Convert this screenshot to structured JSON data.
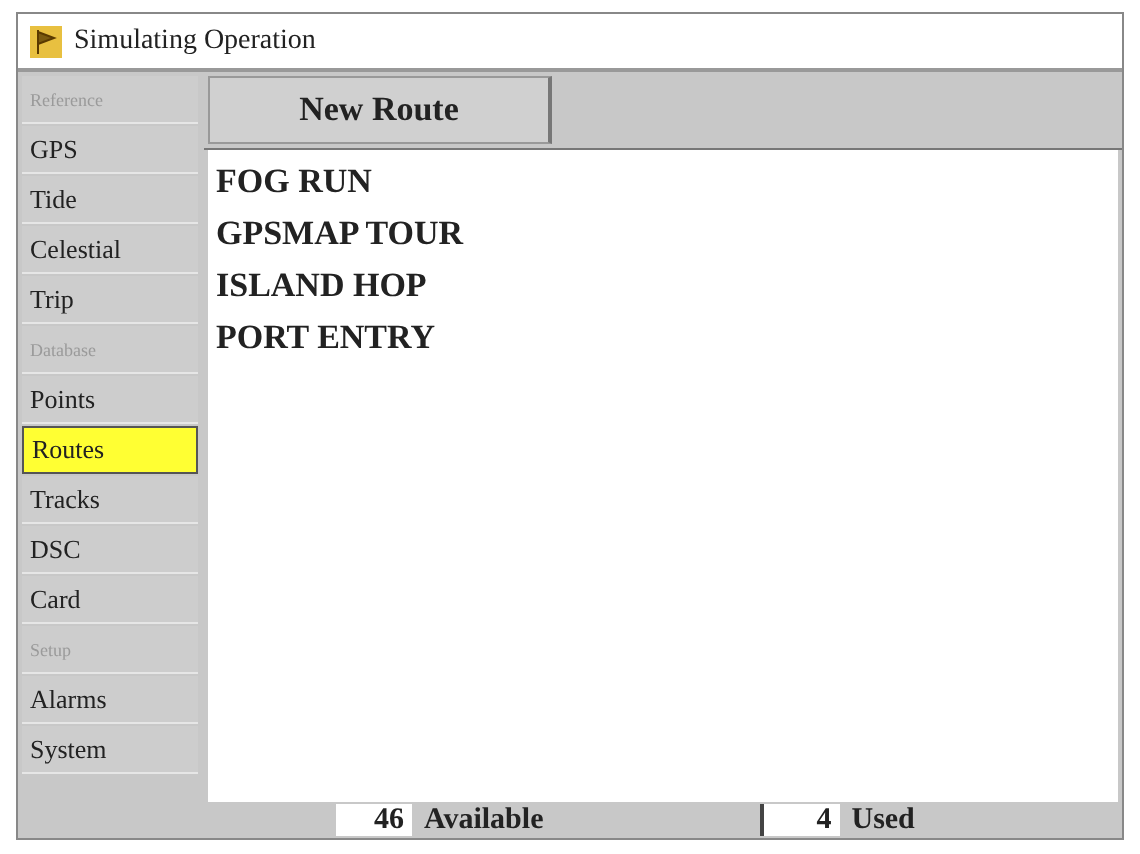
{
  "window": {
    "title": "Simulating Operation"
  },
  "sidebar": {
    "items": [
      {
        "label": "Reference",
        "kind": "header",
        "selected": false
      },
      {
        "label": "GPS",
        "kind": "item",
        "selected": false
      },
      {
        "label": "Tide",
        "kind": "item",
        "selected": false
      },
      {
        "label": "Celestial",
        "kind": "item",
        "selected": false
      },
      {
        "label": "Trip",
        "kind": "item",
        "selected": false
      },
      {
        "label": "Database",
        "kind": "header",
        "selected": false
      },
      {
        "label": "Points",
        "kind": "item",
        "selected": false
      },
      {
        "label": "Routes",
        "kind": "item",
        "selected": true
      },
      {
        "label": "Tracks",
        "kind": "item",
        "selected": false
      },
      {
        "label": "DSC",
        "kind": "item",
        "selected": false
      },
      {
        "label": "Card",
        "kind": "item",
        "selected": false
      },
      {
        "label": "Setup",
        "kind": "header",
        "selected": false
      },
      {
        "label": "Alarms",
        "kind": "item",
        "selected": false
      },
      {
        "label": "System",
        "kind": "item",
        "selected": false
      }
    ]
  },
  "tabs": [
    {
      "label": "New Route",
      "selected": true
    }
  ],
  "routes": [
    "FOG RUN",
    "GPSMAP TOUR",
    "ISLAND HOP",
    "PORT ENTRY"
  ],
  "status_bar": {
    "available_count": "46",
    "available_label": "Available",
    "used_count": "4",
    "used_label": "Used"
  }
}
